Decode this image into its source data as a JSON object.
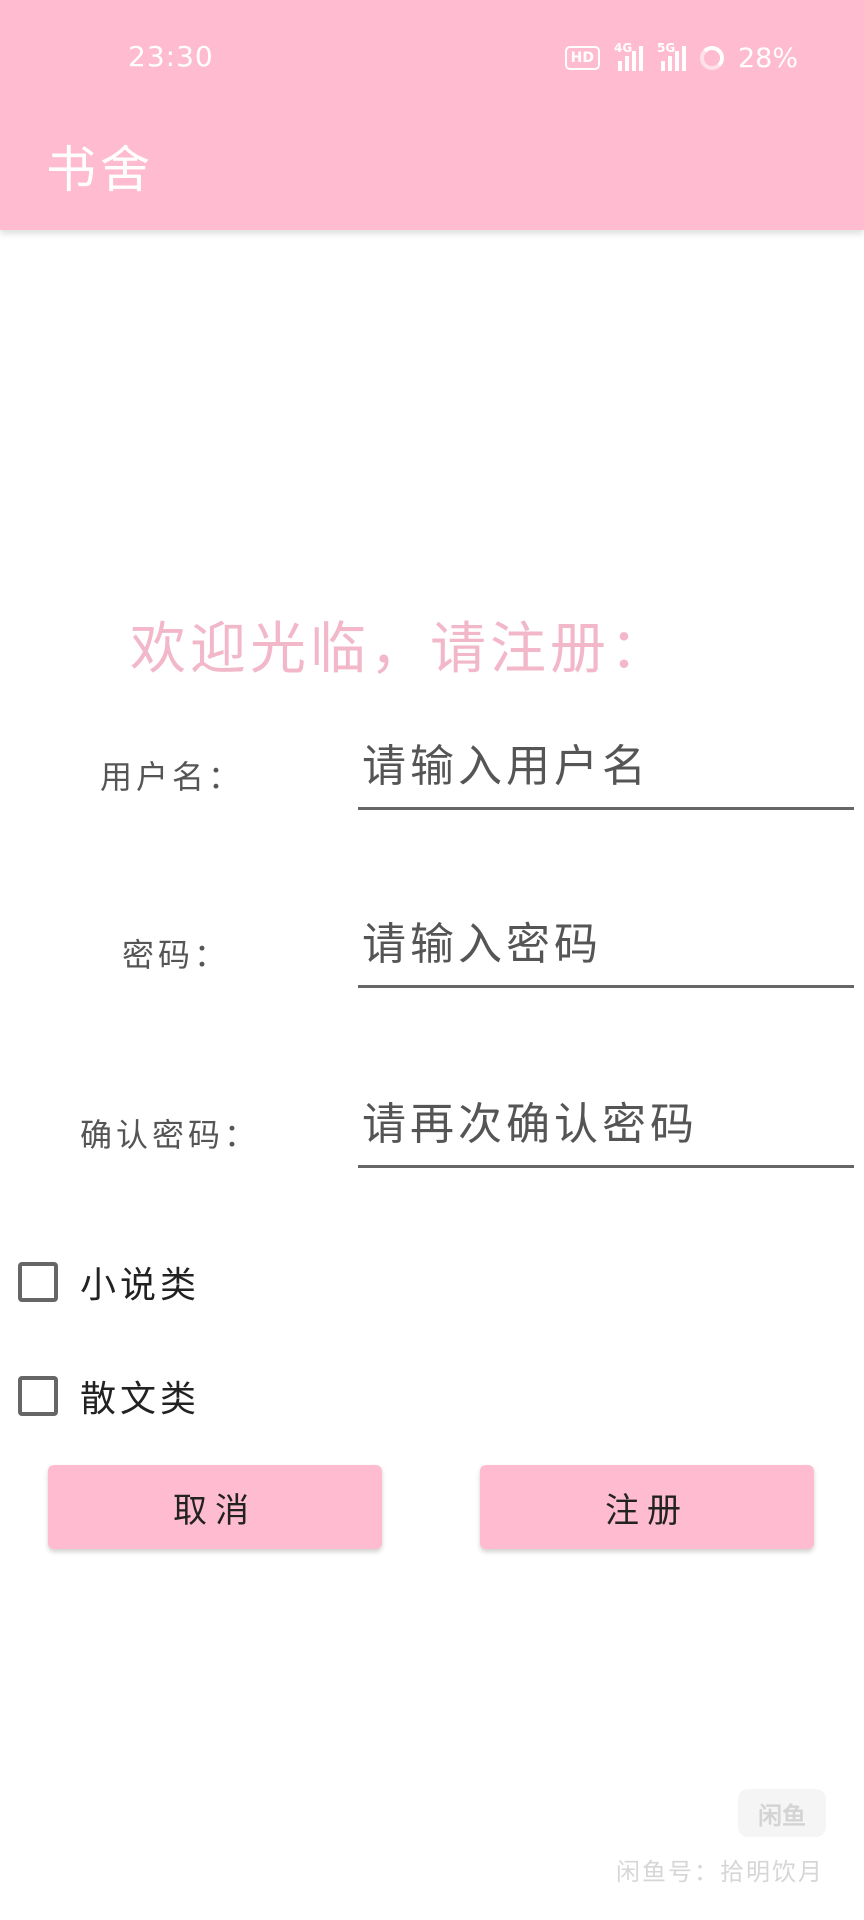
{
  "status_bar": {
    "time": "23:30",
    "hd_badge": "HD",
    "signal_1_tag": "4G",
    "signal_2_tag": "5G",
    "battery": "28%"
  },
  "app_bar": {
    "title": "书舍"
  },
  "welcome": "欢迎光临，请注册：",
  "form": {
    "username": {
      "label": "用户名：",
      "placeholder": "请输入用户名",
      "value": ""
    },
    "password": {
      "label": "密码：",
      "placeholder": "请输入密码",
      "value": ""
    },
    "confirm": {
      "label": "确认密码：",
      "placeholder": "请再次确认密码",
      "value": ""
    }
  },
  "categories": [
    {
      "label": "小说类",
      "checked": false
    },
    {
      "label": "散文类",
      "checked": false
    }
  ],
  "buttons": {
    "cancel": "取消",
    "register": "注册"
  },
  "watermark": {
    "logo": "闲鱼",
    "text": "闲鱼号：拾明饮月"
  },
  "colors": {
    "accent": "#FFBBCF",
    "welcome": "#F2B8CA"
  }
}
